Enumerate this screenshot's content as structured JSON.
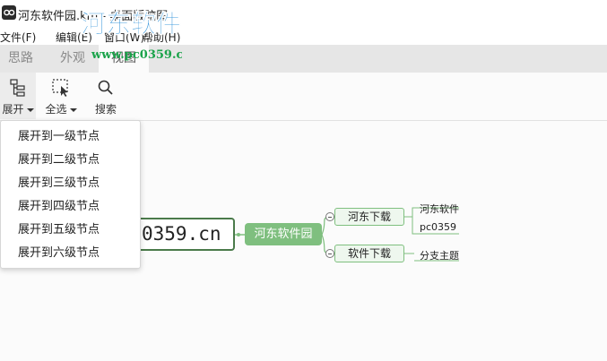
{
  "window": {
    "title": "河东软件园.km - 桌面版脑图"
  },
  "watermark": {
    "logo_text": "河东软件园",
    "url": "www.pc0359.cn"
  },
  "menubar": {
    "items": [
      {
        "label": "文件(F)"
      },
      {
        "label": "编辑(E)"
      },
      {
        "label": "窗口(W)"
      },
      {
        "label": "帮助(H)"
      }
    ]
  },
  "tabs": [
    {
      "label": "思路",
      "active": false
    },
    {
      "label": "外观",
      "active": false
    },
    {
      "label": "视图",
      "active": true
    }
  ],
  "ribbon": {
    "expand": {
      "label": "展开",
      "icon": "expand-tree-icon"
    },
    "select_all": {
      "label": "全选",
      "icon": "select-area-icon"
    },
    "search": {
      "label": "搜索",
      "icon": "magnifier-icon"
    }
  },
  "expand_menu": {
    "items": [
      {
        "label": "展开到一级节点"
      },
      {
        "label": "展开到二级节点"
      },
      {
        "label": "展开到三级节点"
      },
      {
        "label": "展开到四级节点"
      },
      {
        "label": "展开到五级节点"
      },
      {
        "label": "展开到六级节点"
      }
    ]
  },
  "mindmap": {
    "root": "0359.cn",
    "main": "河东软件园",
    "branches": [
      {
        "label": "河东下载",
        "children": [
          "河东软件",
          "pc0359"
        ]
      },
      {
        "label": "软件下载",
        "children": [
          "分支主题"
        ]
      }
    ]
  },
  "colors": {
    "accent_green": "#7fbf7f",
    "root_border": "#4a7a4a",
    "watermark_blue": "#2a8fd8",
    "watermark_green": "#1aa34a"
  }
}
